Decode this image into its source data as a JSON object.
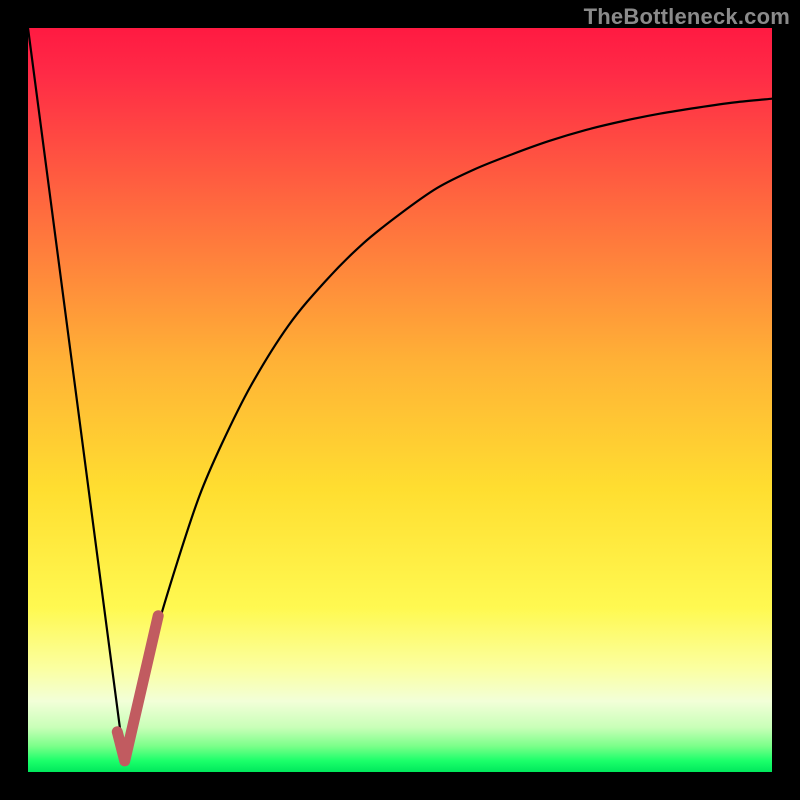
{
  "watermark": "TheBottleneck.com",
  "gradient_stops": [
    {
      "offset": 0,
      "color": "#ff1a42"
    },
    {
      "offset": 0.06,
      "color": "#ff2a46"
    },
    {
      "offset": 0.25,
      "color": "#ff6d3e"
    },
    {
      "offset": 0.45,
      "color": "#ffb236"
    },
    {
      "offset": 0.62,
      "color": "#ffde30"
    },
    {
      "offset": 0.78,
      "color": "#fff951"
    },
    {
      "offset": 0.86,
      "color": "#fbffa0"
    },
    {
      "offset": 0.905,
      "color": "#f2ffd8"
    },
    {
      "offset": 0.94,
      "color": "#c9ffb8"
    },
    {
      "offset": 0.965,
      "color": "#7cff8a"
    },
    {
      "offset": 0.985,
      "color": "#1bff6a"
    },
    {
      "offset": 1.0,
      "color": "#00e85c"
    }
  ],
  "colors": {
    "curve_black": "#000000",
    "tick_pink": "#c15b60"
  },
  "chart_data": {
    "type": "line",
    "title": "",
    "xlabel": "",
    "ylabel": "",
    "xlim": [
      0,
      100
    ],
    "ylim": [
      0,
      100
    ],
    "series": [
      {
        "name": "left-line",
        "x": [
          0,
          13
        ],
        "y": [
          100,
          1
        ]
      },
      {
        "name": "right-curve",
        "x": [
          13,
          15,
          17,
          20,
          23,
          26,
          30,
          35,
          40,
          45,
          50,
          55,
          60,
          65,
          70,
          75,
          80,
          85,
          90,
          95,
          100
        ],
        "y": [
          1,
          10,
          18,
          28,
          37,
          44,
          52,
          60,
          66,
          71,
          75,
          78.5,
          81,
          83,
          84.8,
          86.3,
          87.5,
          88.5,
          89.3,
          90,
          90.5
        ]
      },
      {
        "name": "pink-tick",
        "x": [
          12,
          13,
          17.5
        ],
        "y": [
          5.4,
          1.5,
          21
        ]
      }
    ]
  }
}
